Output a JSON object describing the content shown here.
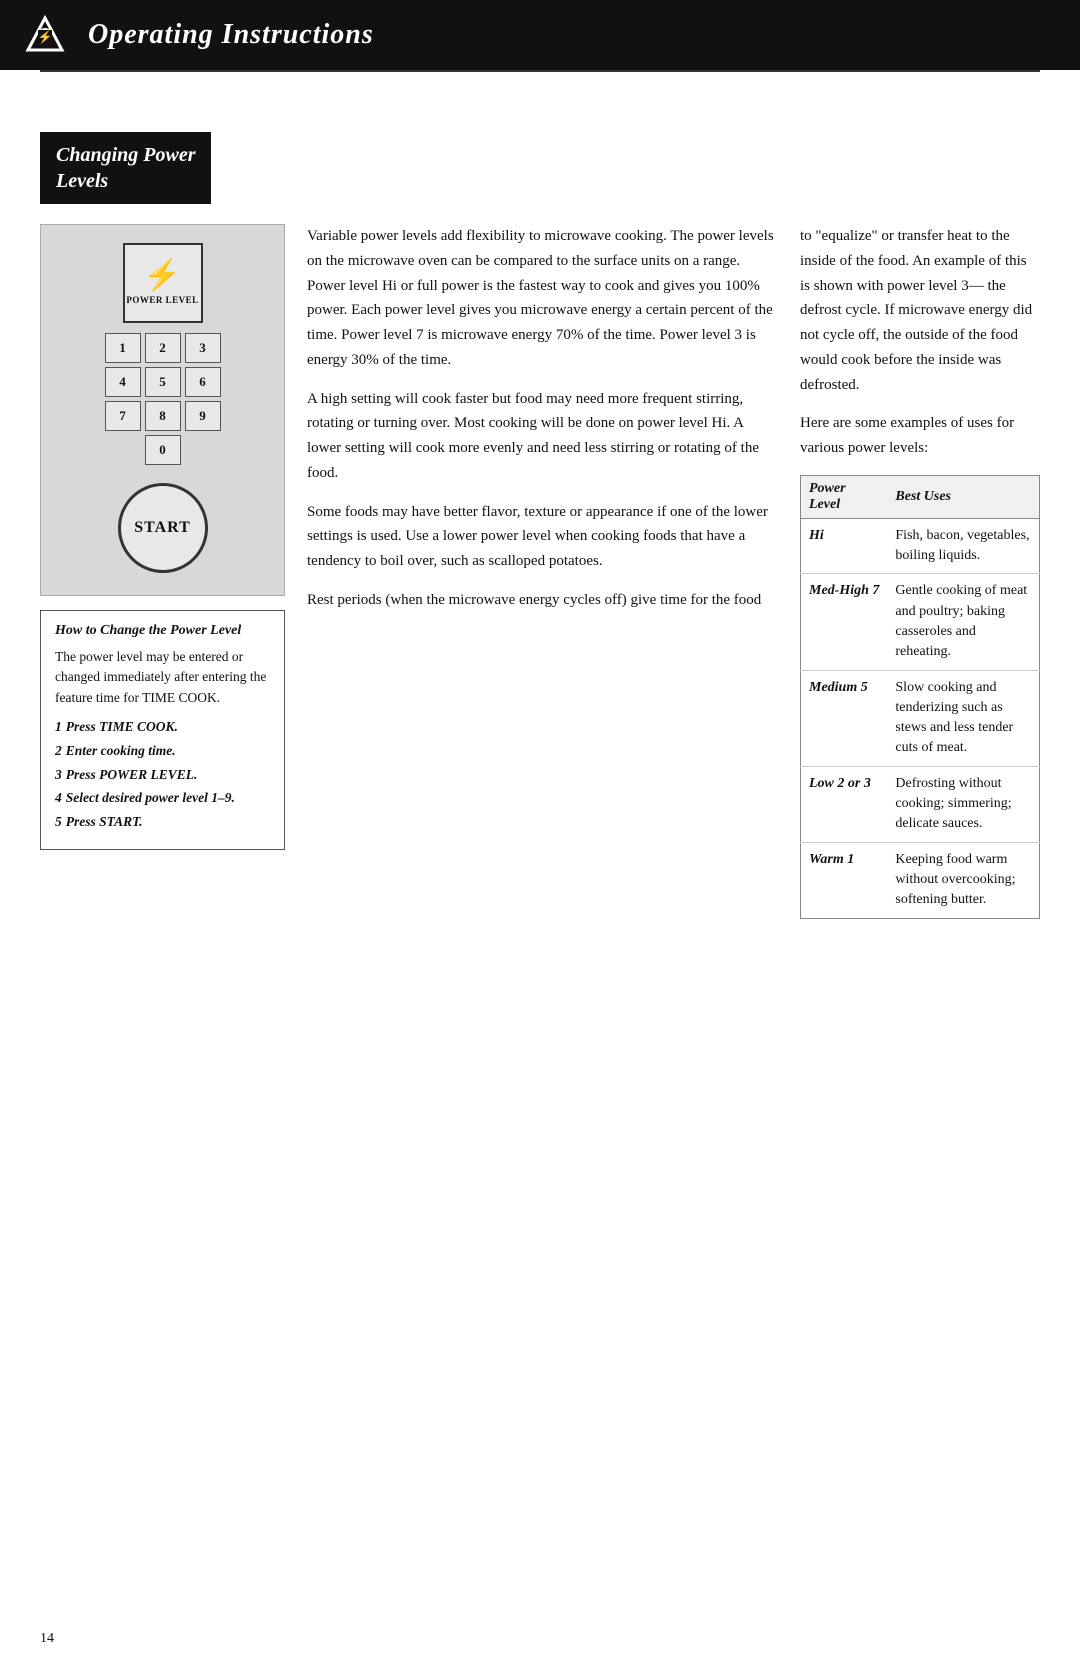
{
  "header": {
    "title": "Operating Instructions",
    "logo_alt": "brand-logo"
  },
  "section": {
    "heading_line1": "Changing Power",
    "heading_line2": "Levels"
  },
  "keypad": {
    "power_level_label": "POWER LEVEL",
    "keys": [
      "1",
      "2",
      "3",
      "4",
      "5",
      "6",
      "7",
      "8",
      "9",
      "0"
    ],
    "start_label": "START"
  },
  "instructions_box": {
    "title": "How to Change the Power Level",
    "intro": "The power level may be entered or changed immediately after entering the feature time for TIME COOK.",
    "steps": [
      "Press TIME COOK.",
      "Enter cooking time.",
      "Press POWER LEVEL.",
      "Select desired power level 1–9.",
      "Press START."
    ]
  },
  "mid_text": {
    "para1": "Variable power levels add flexibility to microwave cooking. The power levels on the microwave oven can be compared to the surface units on a range. Power level Hi or full power is the fastest way to cook and gives you 100% power. Each power level gives you microwave energy a certain percent of the time. Power level 7 is microwave energy 70% of the time. Power level 3 is energy 30% of the time.",
    "para2": "A high setting will cook faster but food may need more frequent stirring, rotating or turning over. Most cooking will be done on power level Hi. A lower setting will cook more evenly and need less stirring or rotating of the food.",
    "para3": "Some foods may have better flavor, texture or appearance if one of the lower settings is used. Use a lower power level when cooking foods that have a tendency to boil over, such as scalloped potatoes.",
    "para4": "Rest periods (when the microwave energy cycles off) give time for the food"
  },
  "right_text": {
    "para1": "to \"equalize\" or transfer heat to the inside of the food. An example of this is shown with power level 3— the defrost cycle. If microwave energy did not cycle off, the outside of the food would cook before the inside was defrosted.",
    "para2": "Here are some examples of uses for various power levels:"
  },
  "power_table": {
    "col1_header": "Power Level",
    "col2_header": "Best Uses",
    "rows": [
      {
        "level": "Hi",
        "uses": "Fish, bacon, vegetables, boiling liquids."
      },
      {
        "level": "Med-High 7",
        "uses": "Gentle cooking of meat and poultry; baking casseroles and reheating."
      },
      {
        "level": "Medium 5",
        "uses": "Slow cooking and tenderizing such as stews and less tender cuts of meat."
      },
      {
        "level": "Low 2 or 3",
        "uses": "Defrosting without cooking; simmering; delicate sauces."
      },
      {
        "level": "Warm 1",
        "uses": "Keeping food warm without overcooking; softening butter."
      }
    ]
  },
  "page_number": "14"
}
